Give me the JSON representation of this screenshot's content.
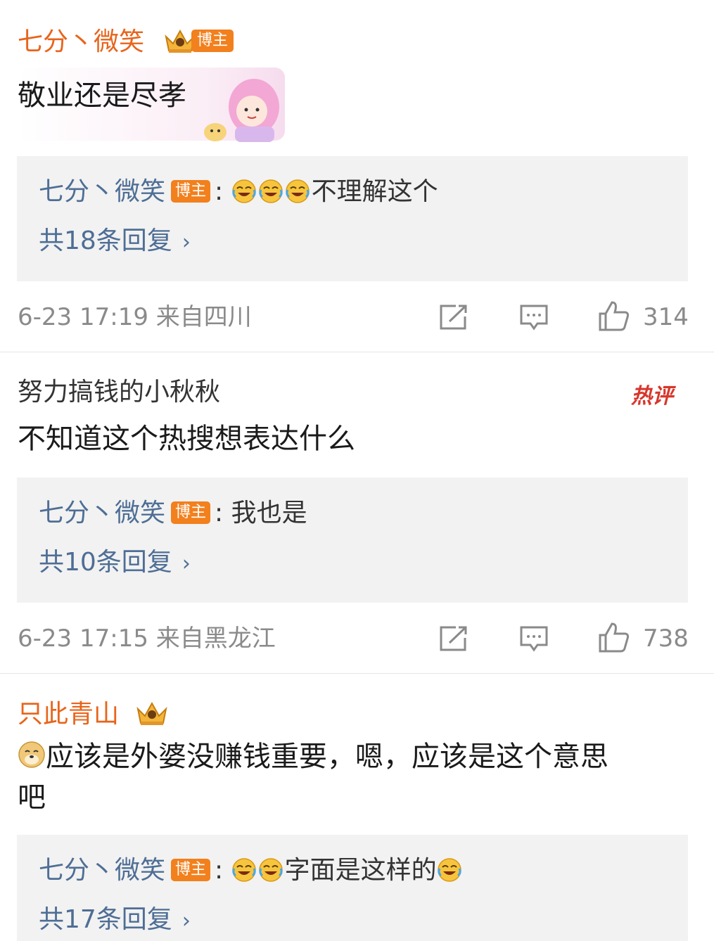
{
  "comments": [
    {
      "username": "七分丶微笑",
      "badge": "博主",
      "text": "敬业还是尽孝",
      "reply": {
        "name": "七分丶微笑",
        "tag": "博主",
        "text": "不理解这个"
      },
      "reply_count": "共18条回复",
      "meta": "6-23 17:19  来自四川",
      "likes": "314"
    },
    {
      "username": "努力搞钱的小秋秋",
      "hot_label": "热评",
      "text": "不知道这个热搜想表达什么",
      "reply": {
        "name": "七分丶微笑",
        "tag": "博主",
        "text": "我也是"
      },
      "reply_count": "共10条回复",
      "meta": "6-23 17:15  来自黑龙江",
      "likes": "738"
    },
    {
      "username": "只此青山",
      "text_line1": "应该是外婆没赚钱重要，嗯，应该是这个意思",
      "text_line2": "吧",
      "reply": {
        "name": "七分丶微笑",
        "tag": "博主",
        "text": "字面是这样的"
      },
      "reply_count": "共17条回复"
    }
  ],
  "icons": {
    "share": "share-icon",
    "comment": "comment-icon",
    "like": "thumbs-up-icon",
    "laugh": "laugh-cry-emoji",
    "doge": "doge-emoji",
    "crown": "crown-icon",
    "chevron": "chevron-right-icon"
  },
  "colors": {
    "vip_name": "#e8641b",
    "reply_name": "#4e6e95",
    "blogger_tag": "#f2801d",
    "reply_bg": "#f2f2f2",
    "hot": "#d8362b"
  }
}
